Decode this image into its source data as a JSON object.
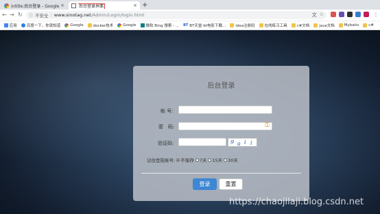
{
  "browser": {
    "tabs": [
      {
        "title": "intitle:后台登录 - Google 搜索",
        "icon": "google-icon"
      },
      {
        "title": "后台登录界面",
        "icon": "document-icon",
        "active": true
      }
    ],
    "new_tab": "+",
    "close": "×",
    "address": {
      "security": "不安全",
      "host": "www.sinotag.net",
      "path": "/Admin/Login/login.html"
    },
    "bookmarks": [
      {
        "label": "应用",
        "icon": "apps-icon"
      },
      {
        "label": "百度一下，你就知道",
        "icon": "baidu-icon"
      },
      {
        "label": "Google",
        "icon": "google-icon"
      },
      {
        "label": "docker技术",
        "icon": "folder-icon"
      },
      {
        "label": "Google",
        "icon": "google-icon"
      },
      {
        "label": "微软 Bing 搜索 - ...",
        "icon": "bing-icon"
      },
      {
        "label": "BT天堂-bt电影下载...",
        "icon": "bt-icon"
      },
      {
        "label": "idea注册码",
        "icon": "folder-icon"
      },
      {
        "label": "在线练习工具",
        "icon": "folder-icon"
      },
      {
        "label": "c#文档",
        "icon": "folder-icon"
      },
      {
        "label": "java文档",
        "icon": "folder-icon"
      },
      {
        "label": "Mybatis",
        "icon": "folder-icon"
      },
      {
        "label": "c#",
        "icon": "folder-icon"
      }
    ]
  },
  "login": {
    "title": "后台登录",
    "account_label": "帐 号:",
    "password_label": "密　码:",
    "captcha_label": "验证码:",
    "captcha_text": [
      "9",
      "a",
      "i",
      "i"
    ],
    "remember_label": "记住登陆账号:",
    "remember_options": [
      "不保存",
      "7天",
      "15天",
      "30天"
    ],
    "remember_selected": "不保存",
    "login_button": "登录",
    "reset_button": "重置"
  },
  "watermark": "https://chaojilaji.blog.csdn.net",
  "colors": {
    "login_button": "#3d87d3",
    "tab_highlight": "#d23a3a"
  }
}
